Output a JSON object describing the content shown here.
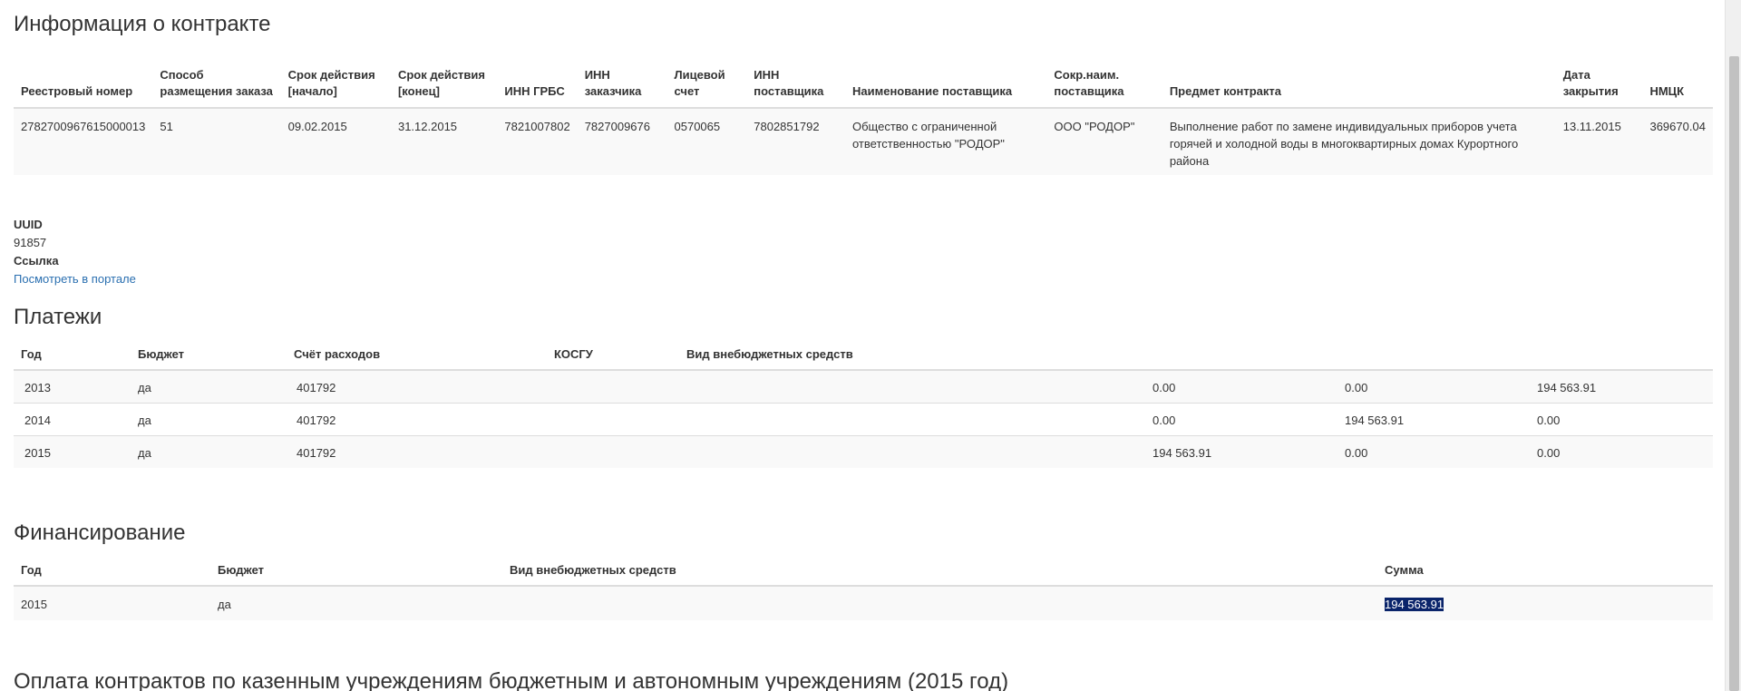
{
  "contract": {
    "title": "Информация о контракте",
    "headers": [
      "Реестровый номер",
      "Способ размещения заказа",
      "Срок действия [начало]",
      "Срок действия [конец]",
      "ИНН ГРБС",
      "ИНН заказчика",
      "Лицевой счет",
      "ИНН поставщика",
      "Наименование поставщика",
      "Сокр.наим. поставщика",
      "Предмет контракта",
      "Дата закрытия",
      "НМЦК"
    ],
    "row": [
      "2782700967615000013",
      "51",
      "09.02.2015",
      "31.12.2015",
      "7821007802",
      "7827009676",
      "0570065",
      "7802851792",
      "Общество с ограниченной ответственностью \"РОДОР\"",
      "ООО \"РОДОР\"",
      "Выполнение работ по замене индивидуальных приборов учета горячей и холодной воды в многоквартирных домах Курортного района",
      "13.11.2015",
      "369670.04"
    ]
  },
  "meta": {
    "uuid_label": "UUID",
    "uuid_value": "91857",
    "link_label": "Ссылка",
    "link_text": "Посмотреть в портале"
  },
  "payments": {
    "title": "Платежи",
    "headers": [
      "Год",
      "Бюджет",
      "Счёт расходов",
      "КОСГУ",
      "Вид внебюджетных средств",
      "",
      "",
      ""
    ],
    "rows": [
      [
        "2013",
        "да",
        "401792",
        "",
        "",
        "0.00",
        "0.00",
        "194 563.91"
      ],
      [
        "2014",
        "да",
        "401792",
        "",
        "",
        "0.00",
        "194 563.91",
        "0.00"
      ],
      [
        "2015",
        "да",
        "401792",
        "",
        "",
        "194 563.91",
        "0.00",
        "0.00"
      ]
    ]
  },
  "financing": {
    "title": "Финансирование",
    "headers": [
      "Год",
      "Бюджет",
      "Вид внебюджетных средств",
      "Сумма"
    ],
    "rows": [
      [
        "2015",
        "да",
        "",
        "194 563.91"
      ]
    ]
  },
  "bottom": {
    "title": "Оплата контрактов по казенным учреждениям бюджетным и автономным учреждениям (2015 год)"
  }
}
